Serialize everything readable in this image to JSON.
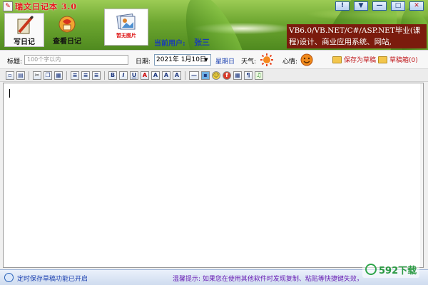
{
  "app": {
    "title": "瑞文日记本 3.0"
  },
  "nav": {
    "write_label": "写日记",
    "view_label": "查看日记"
  },
  "photo": {
    "label": "暂无图片"
  },
  "user": {
    "label": "当前用户:",
    "name": "张三"
  },
  "ad": {
    "line1": "VB6.0/VB.NET/C#/ASP.NET毕业(课",
    "line2": "程)设计、商业应用系统、网站,"
  },
  "window_controls": [
    "hint",
    "dropdown",
    "minimize",
    "maximize",
    "close"
  ],
  "form": {
    "title_label": "标题:",
    "title_placeholder": "100个字以内",
    "date_label": "日期:",
    "date_value": "2021年 1月10日",
    "weekday": "星期日",
    "weather_label": "天气:",
    "mood_label": "心情:",
    "save_draft": "保存为草稿",
    "draft_box": "草稿箱(0)"
  },
  "toolbar": {
    "buttons": [
      "new",
      "open",
      "cut",
      "copy",
      "paste",
      "align-left",
      "align-center",
      "align-right",
      "bold",
      "italic",
      "underline",
      "font-color",
      "font-size-up",
      "font-size-down",
      "font-format",
      "insert-line",
      "insert-image",
      "emoji",
      "flash",
      "table",
      "special-char",
      "music"
    ]
  },
  "status": {
    "left": "定时保存草稿功能已开启",
    "right": "温馨提示: 如果您在使用其他软件时发现复制、粘贴等快捷键失效，请关"
  },
  "watermark": {
    "text": "592下载"
  },
  "colors": {
    "accent_red": "#e8141c",
    "user_blue": "#1a3fb0",
    "ad_bg": "#7b1b0d"
  }
}
